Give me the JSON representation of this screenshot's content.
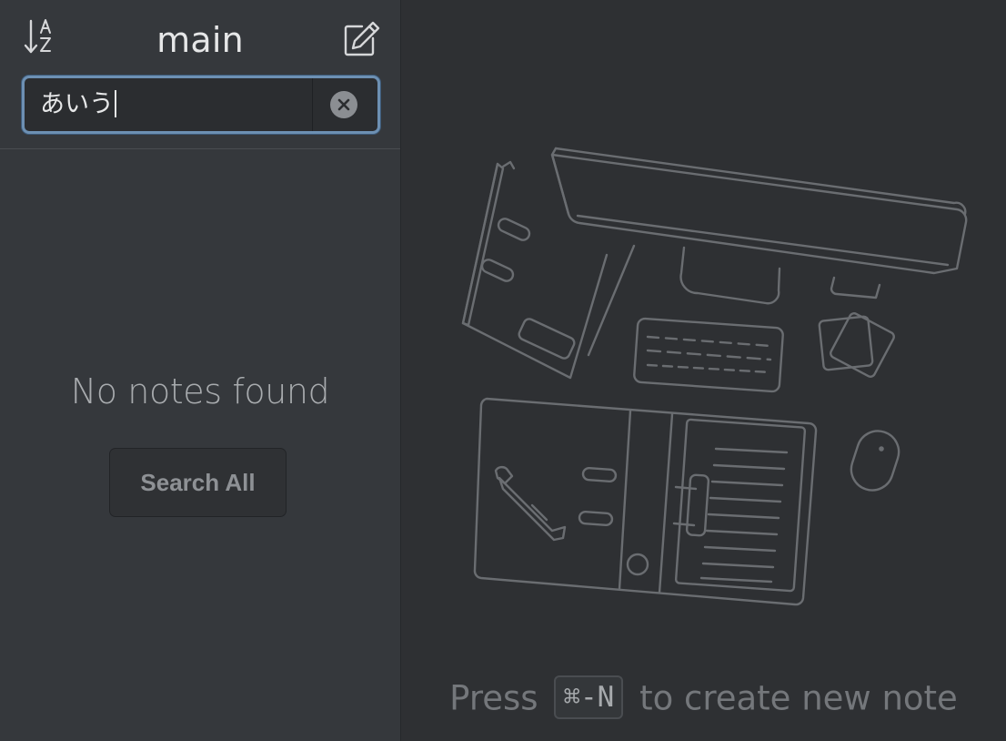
{
  "sidebar": {
    "title": "main",
    "search": {
      "value": "あいう",
      "placeholder": ""
    },
    "empty_message": "No notes found",
    "search_all_label": "Search All"
  },
  "main": {
    "hint_prefix": "Press",
    "hint_shortcut": "⌘-N",
    "hint_suffix": "to create new note"
  },
  "icons": {
    "sort": "sort-az-icon",
    "new_note": "compose-icon",
    "clear": "clear-circle-icon",
    "illustration": "desk-illustration"
  },
  "colors": {
    "sidebar_bg": "#35383c",
    "main_bg": "#2e3033",
    "focus_ring": "#6d90b3",
    "line_art": "#6a6d71"
  }
}
